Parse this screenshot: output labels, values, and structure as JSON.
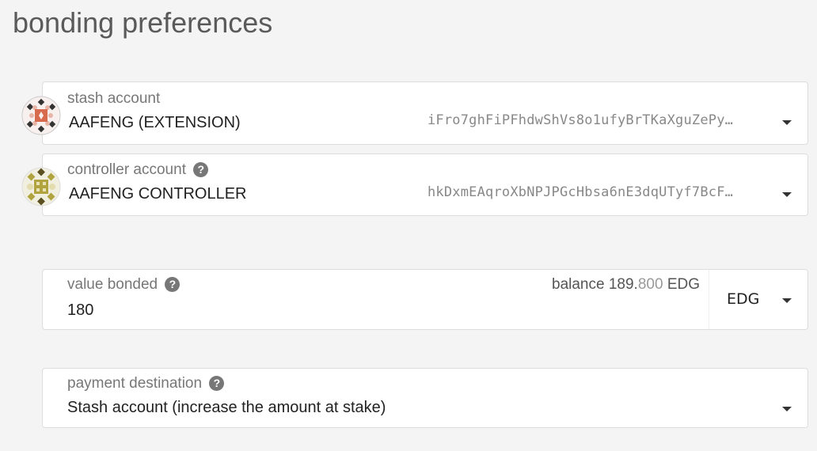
{
  "page": {
    "title": "bonding preferences"
  },
  "stash": {
    "label": "stash account",
    "name": "AAFENG (EXTENSION)",
    "address": "iFro7ghFiPFhdwShVs8o1ufyBrTKaXguZePy…"
  },
  "controller": {
    "label": "controller account",
    "name": "AAFENG  CONTROLLER",
    "address": "hkDxmEAqroXbNPJPGcHbsa6nE3dqUTyf7BcF…"
  },
  "bond": {
    "label": "value bonded",
    "value": "180",
    "balance_label": "balance",
    "balance_int": "189.",
    "balance_dec": "800",
    "balance_unit": "EDG",
    "unit": "EDG"
  },
  "payment": {
    "label": "payment destination",
    "value": "Stash account (increase the amount at stake)"
  },
  "icons": {
    "help": "?"
  }
}
